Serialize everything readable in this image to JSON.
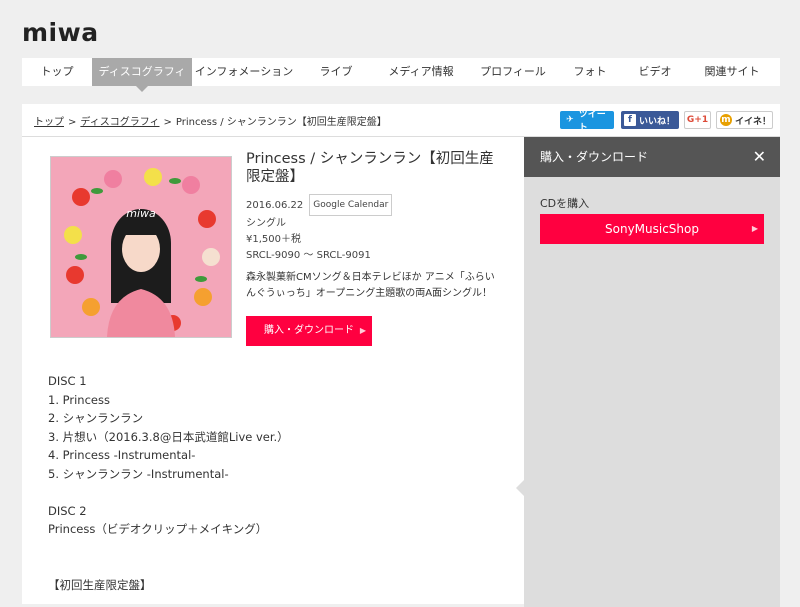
{
  "site": {
    "logo": "miwa"
  },
  "nav": {
    "items": [
      {
        "label": "トップ"
      },
      {
        "label": "ディスコグラフィ",
        "active": true
      },
      {
        "label": "インフォメーション"
      },
      {
        "label": "ライブ"
      },
      {
        "label": "メディア情報"
      },
      {
        "label": "プロフィール"
      },
      {
        "label": "フォト"
      },
      {
        "label": "ビデオ"
      },
      {
        "label": "関連サイト"
      }
    ]
  },
  "breadcrumb": {
    "top": "トップ",
    "sep": ">",
    "discography": "ディスコグラフィ",
    "current": "Princess / シャンランラン【初回生産限定盤】"
  },
  "share": {
    "twitter": "ツイート",
    "facebook": "いいね！",
    "gplus": "G+1",
    "mixi": "イイネ！"
  },
  "release": {
    "title": "Princess / シャンランラン【初回生産限定盤】",
    "date": "2016.06.22",
    "calendar_label": "Google Calendar",
    "type": "シングル",
    "price": "¥1,500＋税",
    "catalog": "SRCL-9090 〜 SRCL-9091",
    "description": "森永製菓新CMソング＆日本テレビほか アニメ「ふらいんぐうぃっち」オープニング主題歌の両A面シングル！",
    "buy_button": "購入・ダウンロード",
    "cover_logo": "miwa"
  },
  "tracklist": {
    "lines": [
      "DISC 1",
      "1. Princess",
      "2. シャンランラン",
      "3. 片想い（2016.3.8@日本武道館Live ver.）",
      "4. Princess -Instrumental-",
      "5. シャンランラン -Instrumental-",
      "",
      "DISC 2",
      "Princess（ビデオクリップ＋メイキング）",
      "",
      "",
      "【初回生産限定盤】"
    ]
  },
  "sidebar": {
    "header": "購入・ダウンロード",
    "close": "✕",
    "cd_label": "CDを購入",
    "shop_button": "SonyMusicShop"
  },
  "colors": {
    "accent": "#ff0040",
    "nav_active": "#a9a9a9",
    "sidebar_head": "#555555",
    "twitter": "#1b95e0",
    "facebook": "#3b5998"
  }
}
